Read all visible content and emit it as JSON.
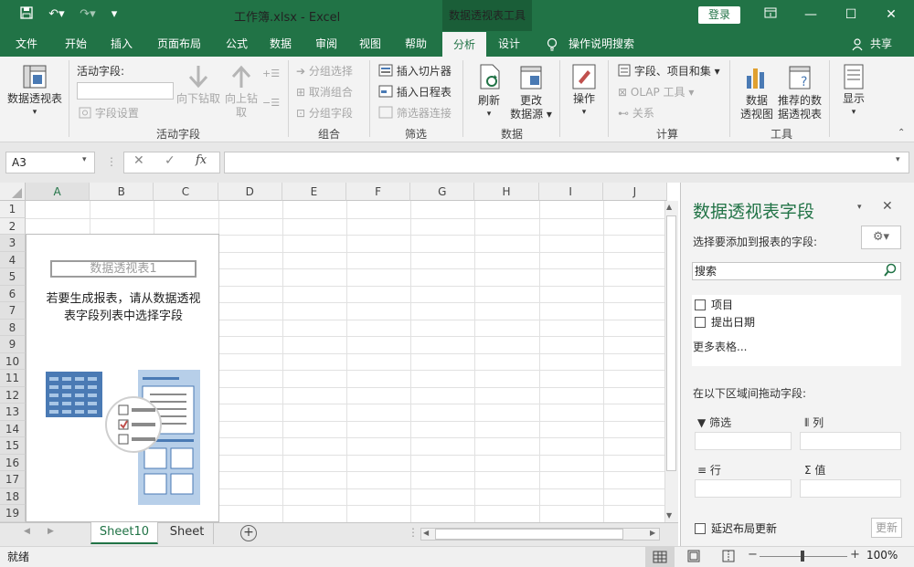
{
  "titlebar": {
    "doc_title": "工作簿.xlsx  -  Excel",
    "context_tab": "数据透视表工具",
    "login": "登录"
  },
  "tabs": [
    "文件",
    "开始",
    "插入",
    "页面布局",
    "公式",
    "数据",
    "审阅",
    "视图",
    "帮助",
    "分析",
    "设计"
  ],
  "tell_me": "操作说明搜索",
  "share": "共享",
  "ribbon": {
    "pivot_table": "数据透视表",
    "active_field_label": "活动字段:",
    "field_settings": "字段设置",
    "drill_down": "向下钻取",
    "drill_up_line1": "向上钻",
    "drill_up_line2": "取",
    "group_active_field": "活动字段",
    "group_selection": "分组选择",
    "ungroup": "取消组合",
    "group_field": "分组字段",
    "group_group": "组合",
    "insert_slicer": "插入切片器",
    "insert_timeline": "插入日程表",
    "filter_connections": "筛选器连接",
    "group_filter": "筛选",
    "refresh": "刷新",
    "change_source_line1": "更改",
    "change_source_line2": "数据源",
    "group_data": "数据",
    "actions": "操作",
    "fields_items_sets": "字段、项目和集",
    "olap_tools": "OLAP 工具",
    "relationships": "关系",
    "group_calc": "计算",
    "pivot_chart_line1": "数据",
    "pivot_chart_line2": "透视图",
    "recommended_line1": "推荐的数",
    "recommended_line2": "据透视表",
    "group_tools": "工具",
    "show": "显示"
  },
  "formula_bar": {
    "name_box": "A3"
  },
  "grid": {
    "columns": [
      "A",
      "B",
      "C",
      "D",
      "E",
      "F",
      "G",
      "H",
      "I",
      "J"
    ],
    "rows": [
      "1",
      "2",
      "3",
      "4",
      "5",
      "6",
      "7",
      "8",
      "9",
      "10",
      "11",
      "12",
      "13",
      "14",
      "15",
      "16",
      "17",
      "18",
      "19"
    ]
  },
  "pivot_placeholder": {
    "name": "数据透视表1",
    "hint_line1": "若要生成报表，请从数据透视",
    "hint_line2": "表字段列表中选择字段"
  },
  "sheets": [
    "Sheet10",
    "Sheet"
  ],
  "status": {
    "ready": "就绪",
    "zoom": "100%"
  },
  "field_pane": {
    "title": "数据透视表字段",
    "subtitle": "选择要添加到报表的字段:",
    "search_placeholder": "搜索",
    "fields": [
      "项目",
      "提出日期"
    ],
    "more_tables": "更多表格...",
    "drag_hint": "在以下区域间拖动字段:",
    "areas": {
      "filters": "筛选",
      "columns": "列",
      "rows": "行",
      "values": "值"
    },
    "defer_update": "延迟布局更新",
    "update_button": "更新"
  },
  "colors": {
    "brand": "#217346",
    "context_tab": "#1a5e38",
    "pivot_icon_blue": "#4a7ab4",
    "pivot_icon_light": "#a8c6e6"
  }
}
